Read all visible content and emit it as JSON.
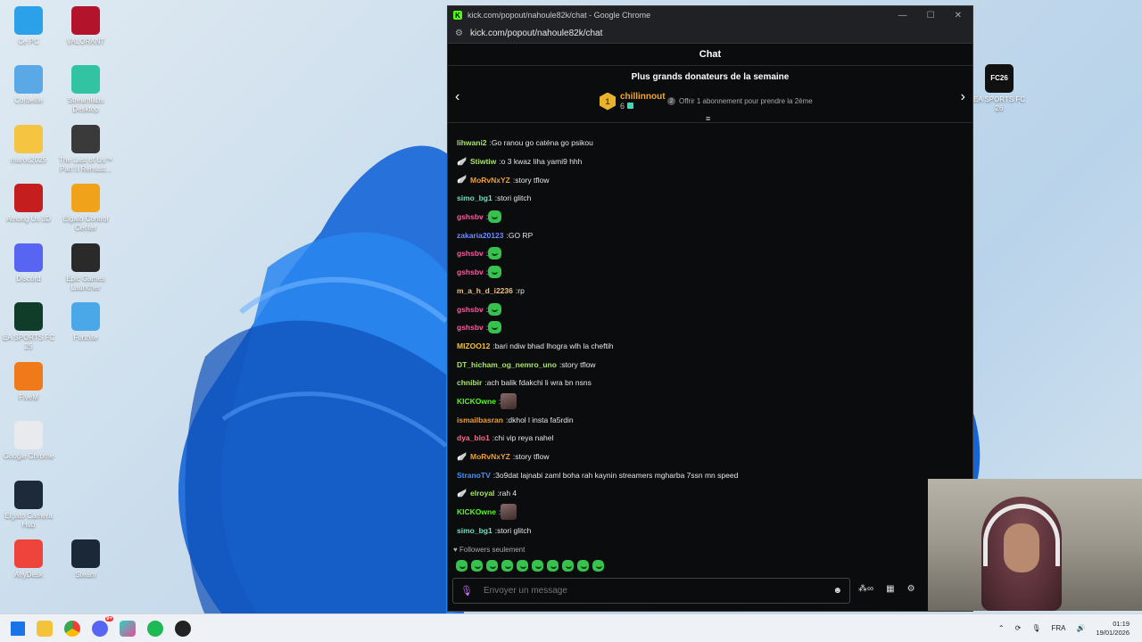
{
  "desktop": {
    "icons_left": [
      {
        "label": "Ce PC",
        "color": "#2aa1e8"
      },
      {
        "label": "Corbeille",
        "color": "#5aa9e6"
      },
      {
        "label": "maroc2025",
        "color": "#f5c542"
      },
      {
        "label": "Among Us 3D",
        "color": "#c41e1e"
      },
      {
        "label": "Discord",
        "color": "#5865f2"
      },
      {
        "label": "EA SPORTS FC 25",
        "color": "#0f3d2a"
      },
      {
        "label": "FiveM",
        "color": "#f07a1a"
      },
      {
        "label": "Google Chrome",
        "color": "#e8eaed"
      },
      {
        "label": "Elgato Camera Hub",
        "color": "#1d2a3a"
      },
      {
        "label": "AnyDesk",
        "color": "#ef443b"
      }
    ],
    "icons_col2": [
      {
        "label": "VALORANT",
        "color": "#b3132b"
      },
      {
        "label": "Streamlabs Desktop",
        "color": "#31c3a2"
      },
      {
        "label": "The Last of Us™ Part II Remast...",
        "color": "#3a3a3a"
      },
      {
        "label": "Elgato Control Center",
        "color": "#f0a21a"
      },
      {
        "label": "Epic Games Launcher",
        "color": "#2a2a2a"
      },
      {
        "label": "Fortnite",
        "color": "#4aa8e8"
      },
      {
        "label": "Steam",
        "color": "#1b2838"
      }
    ],
    "icon_right": {
      "label": "EA SPORTS FC 26",
      "color": "#111"
    }
  },
  "window": {
    "title": "kick.com/popout/nahoule82k/chat - Google Chrome",
    "favicon": "K",
    "url": "kick.com/popout/nahoule82k/chat"
  },
  "chat": {
    "header": "Chat",
    "donors_title": "Plus grands donateurs de la semaine",
    "top_donor": {
      "rank": "1",
      "name": "chillinnout",
      "count": "6"
    },
    "offer_text": "Offrir 1 abonnement pour prendre la 2ème",
    "offer_rank": "2",
    "messages": [
      {
        "user": "lihwani2",
        "color": "#a6e36a",
        "badge": "",
        "text": "Go ranou go caténa go psikou",
        "emote": ""
      },
      {
        "user": "Stiwtiw",
        "color": "#a6e36a",
        "badge": "🪽",
        "text": "o 3 kwaz liha yami9 hhh",
        "emote": ""
      },
      {
        "user": "MoRvNxYZ",
        "color": "#f0a030",
        "badge": "🪽",
        "text": "story tflow",
        "emote": ""
      },
      {
        "user": "simo_bg1",
        "color": "#6fe0c0",
        "badge": "",
        "text": "stori glitch",
        "emote": ""
      },
      {
        "user": "gshsbv",
        "color": "#ff5aa0",
        "badge": "",
        "text": "",
        "emote": "green"
      },
      {
        "user": "zakaria20123",
        "color": "#6c8cff",
        "badge": "",
        "text": "GO RP",
        "emote": ""
      },
      {
        "user": "gshsbv",
        "color": "#ff5aa0",
        "badge": "",
        "text": "",
        "emote": "green"
      },
      {
        "user": "gshsbv",
        "color": "#ff5aa0",
        "badge": "",
        "text": "",
        "emote": "green"
      },
      {
        "user": "m_a_h_d_i2236",
        "color": "#f0c080",
        "badge": "",
        "text": "rp",
        "emote": ""
      },
      {
        "user": "gshsbv",
        "color": "#ff5aa0",
        "badge": "",
        "text": "",
        "emote": "green"
      },
      {
        "user": "gshsbv",
        "color": "#ff5aa0",
        "badge": "",
        "text": "",
        "emote": "green"
      },
      {
        "user": "MIZOO12",
        "color": "#f0c040",
        "badge": "",
        "text": "bari ndiw bhad lhogra wlh la cheftih",
        "emote": ""
      },
      {
        "user": "DT_hicham_og_nemro_uno",
        "color": "#a6e36a",
        "badge": "",
        "text": "story tflow",
        "emote": ""
      },
      {
        "user": "chnibir",
        "color": "#a6e36a",
        "badge": "",
        "text": "ach balik fdakchi li wra bn nsns",
        "emote": ""
      },
      {
        "user": "KICKOwne",
        "color": "#53fc18",
        "badge": "",
        "text": "",
        "emote": "avatar"
      },
      {
        "user": "ismailbasran",
        "color": "#f0a030",
        "badge": "",
        "text": "dkhol l insta fa5rdin",
        "emote": ""
      },
      {
        "user": "dya_blo1",
        "color": "#ff6a8a",
        "badge": "",
        "text": "chi vip reya nahel",
        "emote": ""
      },
      {
        "user": "MoRvNxYZ",
        "color": "#f0a030",
        "badge": "🪽",
        "text": "story tflow",
        "emote": ""
      },
      {
        "user": "StranoTV",
        "color": "#4a90ff",
        "badge": "",
        "text": "3o9dat lajnabi zaml boha rah kaynin streamers mgharba 7ssn mn speed",
        "emote": ""
      },
      {
        "user": "elroyal",
        "color": "#a6e36a",
        "badge": "🪽",
        "text": "rah 4",
        "emote": ""
      },
      {
        "user": "KICKOwne",
        "color": "#53fc18",
        "badge": "",
        "text": "",
        "emote": "avatar"
      },
      {
        "user": "simo_bg1",
        "color": "#6fe0c0",
        "badge": "",
        "text": "stori glitch",
        "emote": ""
      }
    ],
    "followers_only": "Followers seulement",
    "input_placeholder": "Envoyer un message"
  },
  "taskbar": {
    "lang": "FRA",
    "time": "01:19",
    "date": "19/01/2026",
    "discord_badge": "9+"
  }
}
